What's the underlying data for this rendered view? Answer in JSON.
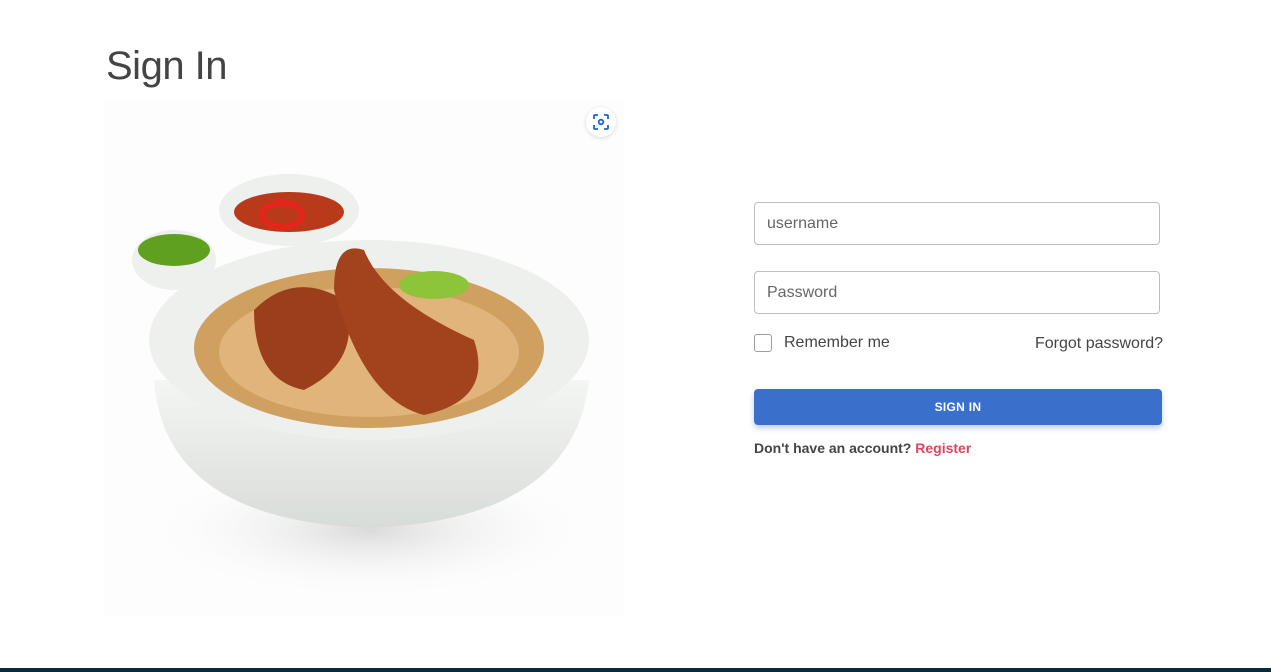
{
  "page": {
    "title": "Sign In"
  },
  "image": {
    "alt_subject": "biryani-bowl",
    "lens_icon": "image-search-icon"
  },
  "form": {
    "username_placeholder": "username",
    "password_placeholder": "Password",
    "remember_label": "Remember me",
    "remember_checked": false,
    "forgot_label": "Forgot password?",
    "signin_label": "SIGN IN",
    "register_prompt": "Don't have an account?",
    "register_label": "Register"
  },
  "colors": {
    "primary": "#3a70cc",
    "link": "#e0455f",
    "footer": "#0a2a3c"
  }
}
